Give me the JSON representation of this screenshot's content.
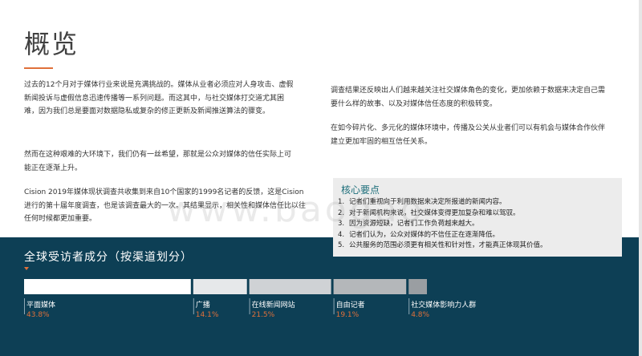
{
  "title": "概览",
  "paragraphs": {
    "p1": "过去的12个月对于媒体行业来说是充满挑战的。媒体从业者必须应对人身攻击、虚假新闻投诉与虚假信息迅速传播等一系列问题。而这其中，与社交媒体打交道尤其困难，因为我们总是要面对数据隐私或复杂的修正更新及新闻推送算法的骤变。",
    "p2": "然而在这种艰难的大环境下，我们仍有一丝希望，那就是公众对媒体的信任实际上可能正在逐渐上升。",
    "p3": "Cision 2019年媒体现状调查共收集到来自10个国家的1999名记者的反馈，这是Cision进行的第十届年度调查，也是该调查最大的一次。其结果显示，相关性和媒体信任比以往任何时候都更加重要。",
    "p4": "调查结果还反映出人们越来越关注社交媒体角色的变化，更加依赖于数据来决定自己需要什么样的故事、以及对媒体信任态度的积极转变。",
    "p5": "在如今碎片化、多元化的媒体环境中，传播及公关从业者们可以有机会与媒体合作伙伴建立更加牢固的相互信任关系。"
  },
  "key_points": {
    "title": "核心要点",
    "items": [
      {
        "num": "1.",
        "text": "记者们重视向于利用数据来决定所报道的新闻内容。"
      },
      {
        "num": "2.",
        "text": "对于新闻机构来说，社交媒体变得更加复杂和难以驾驭。"
      },
      {
        "num": "3.",
        "text": "因为资源短缺，记者们工作负荷越来越大。"
      },
      {
        "num": "4.",
        "text": "记者们认为，公众对媒体的不信任正在逐渐降低。"
      },
      {
        "num": "5.",
        "text": "公共服务的范围必须更有相关性和针对性，才能真正体现其价值。"
      }
    ]
  },
  "watermark": "www.baogao",
  "colors": {
    "band": "#0d3f55",
    "accent": "#e0703a",
    "bars": [
      "#ffffff",
      "#e6e8ea",
      "#cfd2d5",
      "#b4b7ba",
      "#9a9ea2"
    ]
  },
  "chart_data": {
    "type": "bar",
    "title": "全球受访者成分（按渠道划分）",
    "orientation": "horizontal-stacked",
    "categories": [
      "平面媒体",
      "广播",
      "在线新闻网站",
      "自由记者",
      "社交媒体影响力人群"
    ],
    "values": [
      43.8,
      14.1,
      21.5,
      19.1,
      4.8
    ],
    "value_labels": [
      "43.8%",
      "14.1%",
      "21.5%",
      "19.1%",
      "4.8%"
    ]
  }
}
